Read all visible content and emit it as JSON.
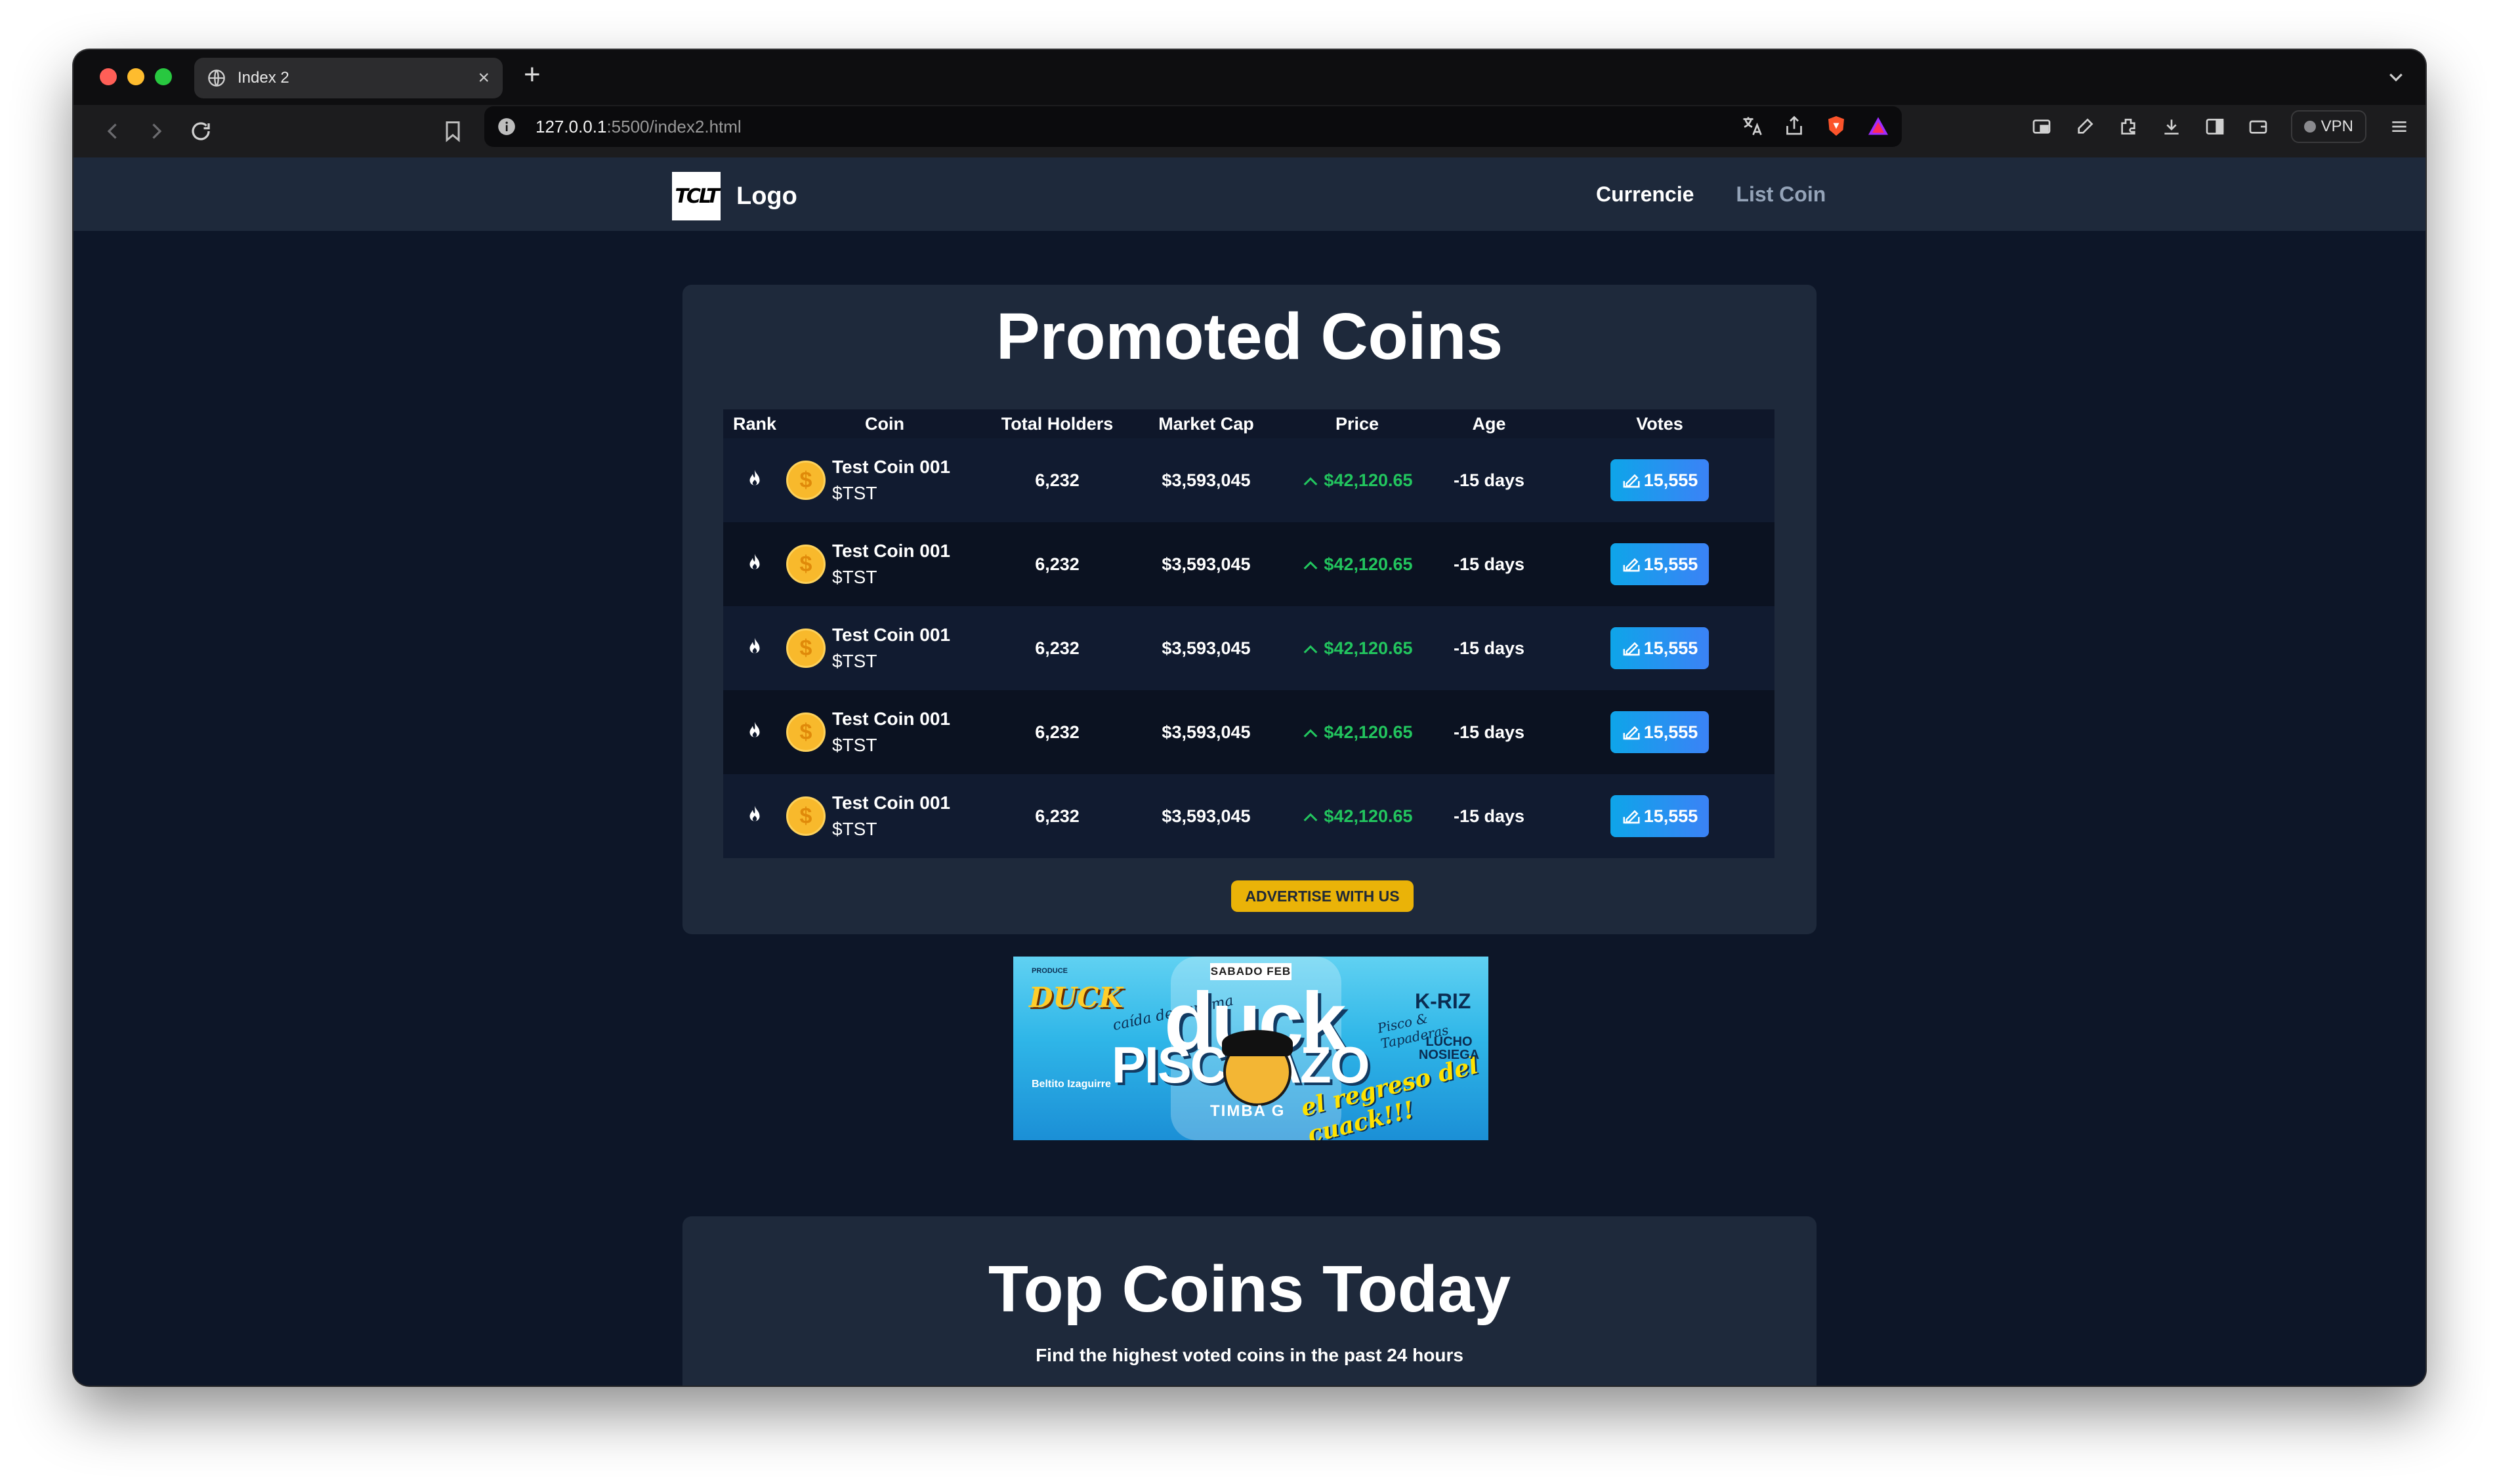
{
  "browser": {
    "tab_title": "Index 2",
    "url_host": "127.0.0.1",
    "url_path": ":5500/index2.html",
    "vpn_label": "VPN"
  },
  "nav": {
    "logo_mark": "TCLT",
    "logo_text": "Logo",
    "links": [
      "Currencie",
      "List Coin"
    ]
  },
  "promoted": {
    "title": "Promoted Coins",
    "columns": [
      "Rank",
      "Coin",
      "Total Holders",
      "Market Cap",
      "Price",
      "Age",
      "Votes"
    ],
    "rows": [
      {
        "name": "Test Coin 001",
        "ticker": "$TST",
        "holders": "6,232",
        "market_cap": "$3,593,045",
        "price": "$42,120.65",
        "age": "-15 days",
        "votes": "15,555"
      },
      {
        "name": "Test Coin 001",
        "ticker": "$TST",
        "holders": "6,232",
        "market_cap": "$3,593,045",
        "price": "$42,120.65",
        "age": "-15 days",
        "votes": "15,555"
      },
      {
        "name": "Test Coin 001",
        "ticker": "$TST",
        "holders": "6,232",
        "market_cap": "$3,593,045",
        "price": "$42,120.65",
        "age": "-15 days",
        "votes": "15,555"
      },
      {
        "name": "Test Coin 001",
        "ticker": "$TST",
        "holders": "6,232",
        "market_cap": "$3,593,045",
        "price": "$42,120.65",
        "age": "-15 days",
        "votes": "15,555"
      },
      {
        "name": "Test Coin 001",
        "ticker": "$TST",
        "holders": "6,232",
        "market_cap": "$3,593,045",
        "price": "$42,120.65",
        "age": "-15 days",
        "votes": "15,555"
      }
    ],
    "advertise_label": "ADVERTISE WITH US",
    "colors": {
      "price": "#22c55e",
      "vote_button": "#0ea5e9",
      "advertise": "#eab308"
    }
  },
  "banner": {
    "date": "SABADO FEB",
    "brand": "DUCK",
    "headline_1": "duck",
    "headline_2": "PISCOAZO",
    "script_1": "caída de espuma",
    "script_2": "Pisco & Tapaderas",
    "tagline": "el regreso del cuack!!!",
    "artist_1": "K-RIZ",
    "artist_2": "LUCHO NOSIEGA",
    "artist_3": "TIMBA G",
    "artist_4": "Beltito Izaguirre",
    "small": "PRODUCE"
  },
  "top_coins": {
    "title": "Top Coins Today",
    "subtitle": "Find the highest voted coins in the past 24 hours"
  }
}
